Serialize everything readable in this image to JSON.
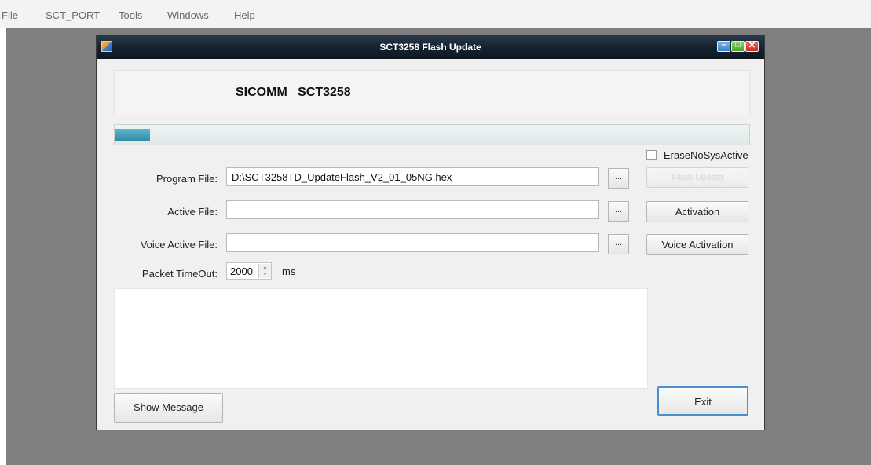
{
  "menu": [
    {
      "mnemonic": "F",
      "rest": "ile"
    },
    {
      "mnemonic": "",
      "rest": "SCT_PORT"
    },
    {
      "mnemonic": "T",
      "rest": "ools"
    },
    {
      "mnemonic": "W",
      "rest": "indows"
    },
    {
      "mnemonic": "H",
      "rest": "elp"
    }
  ],
  "window": {
    "title": "SCT3258 Flash Update",
    "minimize_glyph": "–",
    "maximize_glyph": "□",
    "close_glyph": "✕"
  },
  "header": {
    "text": "SICOMM   SCT3258"
  },
  "progress": {
    "fraction": 0.055
  },
  "options": {
    "erase_label": "EraseNoSysActive",
    "erase_checked": false
  },
  "fields": {
    "program_label": "Program File:",
    "program_value": "D:\\SCT3258TD_UpdateFlash_V2_01_05NG.hex",
    "active_label": "Active File:",
    "active_value": "",
    "voice_label": "Voice Active File:",
    "voice_value": "",
    "browse_label": "..."
  },
  "timeout": {
    "label": "Packet TimeOut:",
    "value": "2000",
    "unit": "ms"
  },
  "buttons": {
    "flash_update": "Flash Update",
    "activation": "Activation",
    "voice_activation": "Voice Activation",
    "show_message": "Show Message",
    "exit": "Exit"
  },
  "colors": {
    "workspace": "#7f7f7f",
    "titlebar": "#14212e",
    "progress_fill": "#2d8aa6"
  }
}
